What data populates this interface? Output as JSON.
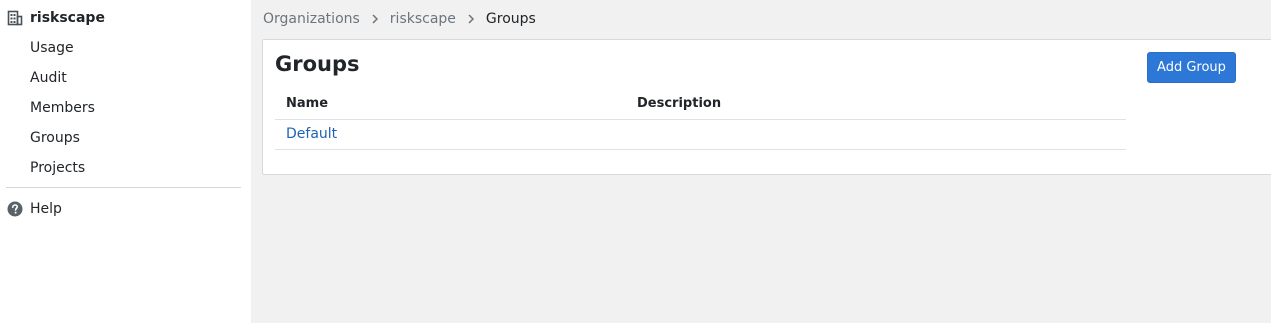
{
  "sidebar": {
    "org_name": "riskscape",
    "org_icon": "building-icon",
    "items": [
      {
        "label": "Usage"
      },
      {
        "label": "Audit"
      },
      {
        "label": "Members"
      },
      {
        "label": "Groups"
      },
      {
        "label": "Projects"
      }
    ],
    "help": {
      "label": "Help",
      "icon": "question-circle-icon"
    }
  },
  "breadcrumb": {
    "items": [
      {
        "label": "Organizations"
      },
      {
        "label": "riskscape"
      }
    ],
    "current": "Groups",
    "separator_icon": "chevron-right-icon"
  },
  "main": {
    "title": "Groups",
    "add_button_label": "Add Group",
    "table": {
      "headers": {
        "name": "Name",
        "description": "Description"
      },
      "rows": [
        {
          "name": "Default",
          "description": ""
        }
      ]
    }
  },
  "colors": {
    "accent": "#2d78d6",
    "link": "#1f63b4",
    "background": "#f1f1f1"
  }
}
